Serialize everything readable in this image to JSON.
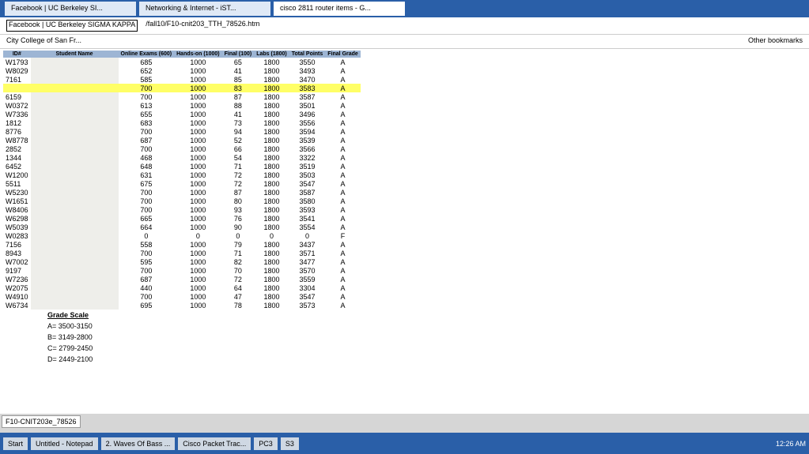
{
  "tabs": [
    "Facebook | UC Berkeley SI...",
    "Networking & Internet - iST...",
    "cisco 2811 router items - G..."
  ],
  "tooltip": "Facebook | UC Berkeley SIGMA KAPPA",
  "url": "/fall10/F10-cnit203_TTH_78526.htm",
  "bookmark": "City College of San Fr...",
  "other_bookmarks": "Other bookmarks",
  "headers": [
    "ID#",
    "Student Name",
    "Online Exams (600)",
    "Hands-on (1000)",
    "Final (100)",
    "Labs (1800)",
    "Total Points",
    "Final Grade"
  ],
  "rows": [
    [
      "W1793",
      "",
      "685",
      "1000",
      "65",
      "1800",
      "3550",
      "A"
    ],
    [
      "W8029",
      "",
      "652",
      "1000",
      "41",
      "1800",
      "3493",
      "A"
    ],
    [
      "7161",
      "",
      "585",
      "1000",
      "85",
      "1800",
      "3470",
      "A"
    ],
    [
      "",
      "",
      "700",
      "1000",
      "83",
      "1800",
      "3583",
      "A"
    ],
    [
      "6159",
      "",
      "700",
      "1000",
      "87",
      "1800",
      "3587",
      "A"
    ],
    [
      "W0372",
      "",
      "613",
      "1000",
      "88",
      "1800",
      "3501",
      "A"
    ],
    [
      "W7336",
      "",
      "655",
      "1000",
      "41",
      "1800",
      "3496",
      "A"
    ],
    [
      "1812",
      "",
      "683",
      "1000",
      "73",
      "1800",
      "3556",
      "A"
    ],
    [
      "8776",
      "",
      "700",
      "1000",
      "94",
      "1800",
      "3594",
      "A"
    ],
    [
      "W8778",
      "",
      "687",
      "1000",
      "52",
      "1800",
      "3539",
      "A"
    ],
    [
      "2852",
      "",
      "700",
      "1000",
      "66",
      "1800",
      "3566",
      "A"
    ],
    [
      "1344",
      "",
      "468",
      "1000",
      "54",
      "1800",
      "3322",
      "A"
    ],
    [
      "6452",
      "",
      "648",
      "1000",
      "71",
      "1800",
      "3519",
      "A"
    ],
    [
      "W1200",
      "",
      "631",
      "1000",
      "72",
      "1800",
      "3503",
      "A"
    ],
    [
      "5511",
      "",
      "675",
      "1000",
      "72",
      "1800",
      "3547",
      "A"
    ],
    [
      "W5230",
      "",
      "700",
      "1000",
      "87",
      "1800",
      "3587",
      "A"
    ],
    [
      "W1651",
      "",
      "700",
      "1000",
      "80",
      "1800",
      "3580",
      "A"
    ],
    [
      "W8406",
      "",
      "700",
      "1000",
      "93",
      "1800",
      "3593",
      "A"
    ],
    [
      "W6298",
      "",
      "665",
      "1000",
      "76",
      "1800",
      "3541",
      "A"
    ],
    [
      "W5039",
      "",
      "664",
      "1000",
      "90",
      "1800",
      "3554",
      "A"
    ],
    [
      "W0283",
      "",
      "0",
      "0",
      "0",
      "0",
      "0",
      "F"
    ],
    [
      "7156",
      "",
      "558",
      "1000",
      "79",
      "1800",
      "3437",
      "A"
    ],
    [
      "8943",
      "",
      "700",
      "1000",
      "71",
      "1800",
      "3571",
      "A"
    ],
    [
      "W7002",
      "",
      "595",
      "1000",
      "82",
      "1800",
      "3477",
      "A"
    ],
    [
      "9197",
      "",
      "700",
      "1000",
      "70",
      "1800",
      "3570",
      "A"
    ],
    [
      "W7236",
      "",
      "687",
      "1000",
      "72",
      "1800",
      "3559",
      "A"
    ],
    [
      "W2075",
      "",
      "440",
      "1000",
      "64",
      "1800",
      "3304",
      "A"
    ],
    [
      "W4910",
      "",
      "700",
      "1000",
      "47",
      "1800",
      "3547",
      "A"
    ],
    [
      "W6734",
      "",
      "695",
      "1000",
      "78",
      "1800",
      "3573",
      "A"
    ]
  ],
  "grade_scale": {
    "title": "Grade Scale",
    "items": [
      "A= 3500-3150",
      "B= 3149-2800",
      "C= 2799-2450",
      "D= 2449-2100"
    ]
  },
  "status": "F10-CNIT203e_78526",
  "taskbar": [
    "Start",
    "Untitled - Notepad",
    "2. Waves Of Bass ...",
    "Cisco Packet Trac...",
    "PC3",
    "S3"
  ],
  "clock": "12:26 AM"
}
